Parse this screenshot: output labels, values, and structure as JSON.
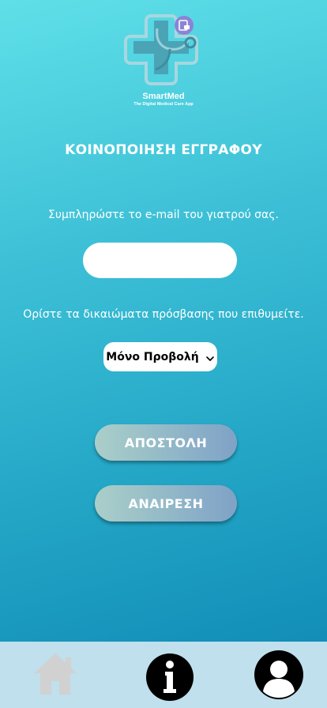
{
  "logo": {
    "brand_name": "SmartMed",
    "tagline": "The Digital Medical Care App",
    "colors": {
      "teal": "#4a9fb0",
      "light": "#a8d7df",
      "badge": "#8a83d6"
    }
  },
  "page": {
    "title": "ΚΟΙΝΟΠΟΙΗΣΗ ΕΓΓΡΑΦΟΥ"
  },
  "email_section": {
    "label": "Συμπληρώστε το e-mail του γιατρού σας.",
    "value": "",
    "placeholder": ""
  },
  "permissions_section": {
    "label": "Ορίστε τα δικαιώματα πρόσβασης που επιθυμείτε.",
    "selected": "Μόνο Προβολή"
  },
  "actions": {
    "send_label": "ΑΠΟΣΤΟΛΗ",
    "cancel_label": "ΑΝΑΙΡΕΣΗ"
  },
  "nav": {
    "items": [
      {
        "icon": "home-icon",
        "color": "#d1d1d1"
      },
      {
        "icon": "info-icon",
        "color": "#000000"
      },
      {
        "icon": "user-profile-icon",
        "color": "#000000"
      }
    ]
  },
  "colors": {
    "gradient_top": "#5fe0e8",
    "gradient_bottom": "#0d86b3",
    "nav_background": "#bfe0ec",
    "button_gradient_start": "#aacfc9",
    "button_gradient_end": "#7fa2c6"
  }
}
